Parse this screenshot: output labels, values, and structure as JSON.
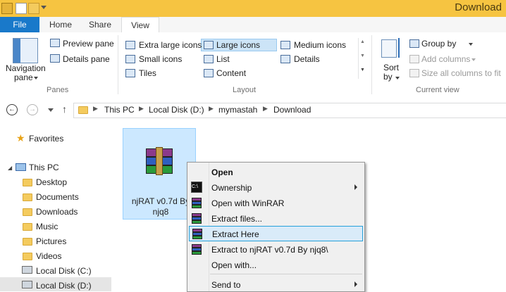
{
  "window": {
    "title": "Download"
  },
  "tabs": [
    {
      "label": "File"
    },
    {
      "label": "Home"
    },
    {
      "label": "Share"
    },
    {
      "label": "View"
    }
  ],
  "ribbon": {
    "panes": {
      "navigation_pane": "Navigation pane",
      "navigation_pane_l1": "Navigation",
      "navigation_pane_l2": "pane",
      "preview_pane": "Preview pane",
      "details_pane": "Details pane",
      "group_label": "Panes"
    },
    "layout": {
      "items": [
        "Extra large icons",
        "Large icons",
        "Medium icons",
        "Small icons",
        "List",
        "Details",
        "Tiles",
        "Content"
      ],
      "selected": "Large icons",
      "group_label": "Layout"
    },
    "current_view": {
      "sort_by_l1": "Sort",
      "sort_by_l2": "by",
      "group_by": "Group by",
      "add_columns": "Add columns",
      "size_columns": "Size all columns to fit",
      "group_label": "Current view"
    }
  },
  "address": {
    "crumbs": [
      "This PC",
      "Local Disk (D:)",
      "mymastah",
      "Download"
    ]
  },
  "nav": {
    "favorites": "Favorites",
    "this_pc": "This PC",
    "items": [
      "Desktop",
      "Documents",
      "Downloads",
      "Music",
      "Pictures",
      "Videos",
      "Local Disk (C:)",
      "Local Disk (D:)"
    ]
  },
  "content": {
    "file": {
      "name_l1": "njRAT v0.7d By",
      "name_l2": "njq8"
    }
  },
  "context_menu": {
    "items": [
      {
        "label": "Open",
        "bold": true
      },
      {
        "label": "Ownership",
        "submenu": true
      },
      {
        "label": "Open with WinRAR"
      },
      {
        "label": "Extract files..."
      },
      {
        "label": "Extract Here",
        "highlighted": true
      },
      {
        "label": "Extract to njRAT v0.7d By njq8\\"
      },
      {
        "label": "Open with..."
      },
      {
        "label": "Send to",
        "submenu": true
      }
    ]
  },
  "colors": {
    "titlebar": "#f6c441",
    "file_tab": "#1979ca",
    "selection": "#cce8ff",
    "menu_highlight": "#d9ebf9"
  }
}
